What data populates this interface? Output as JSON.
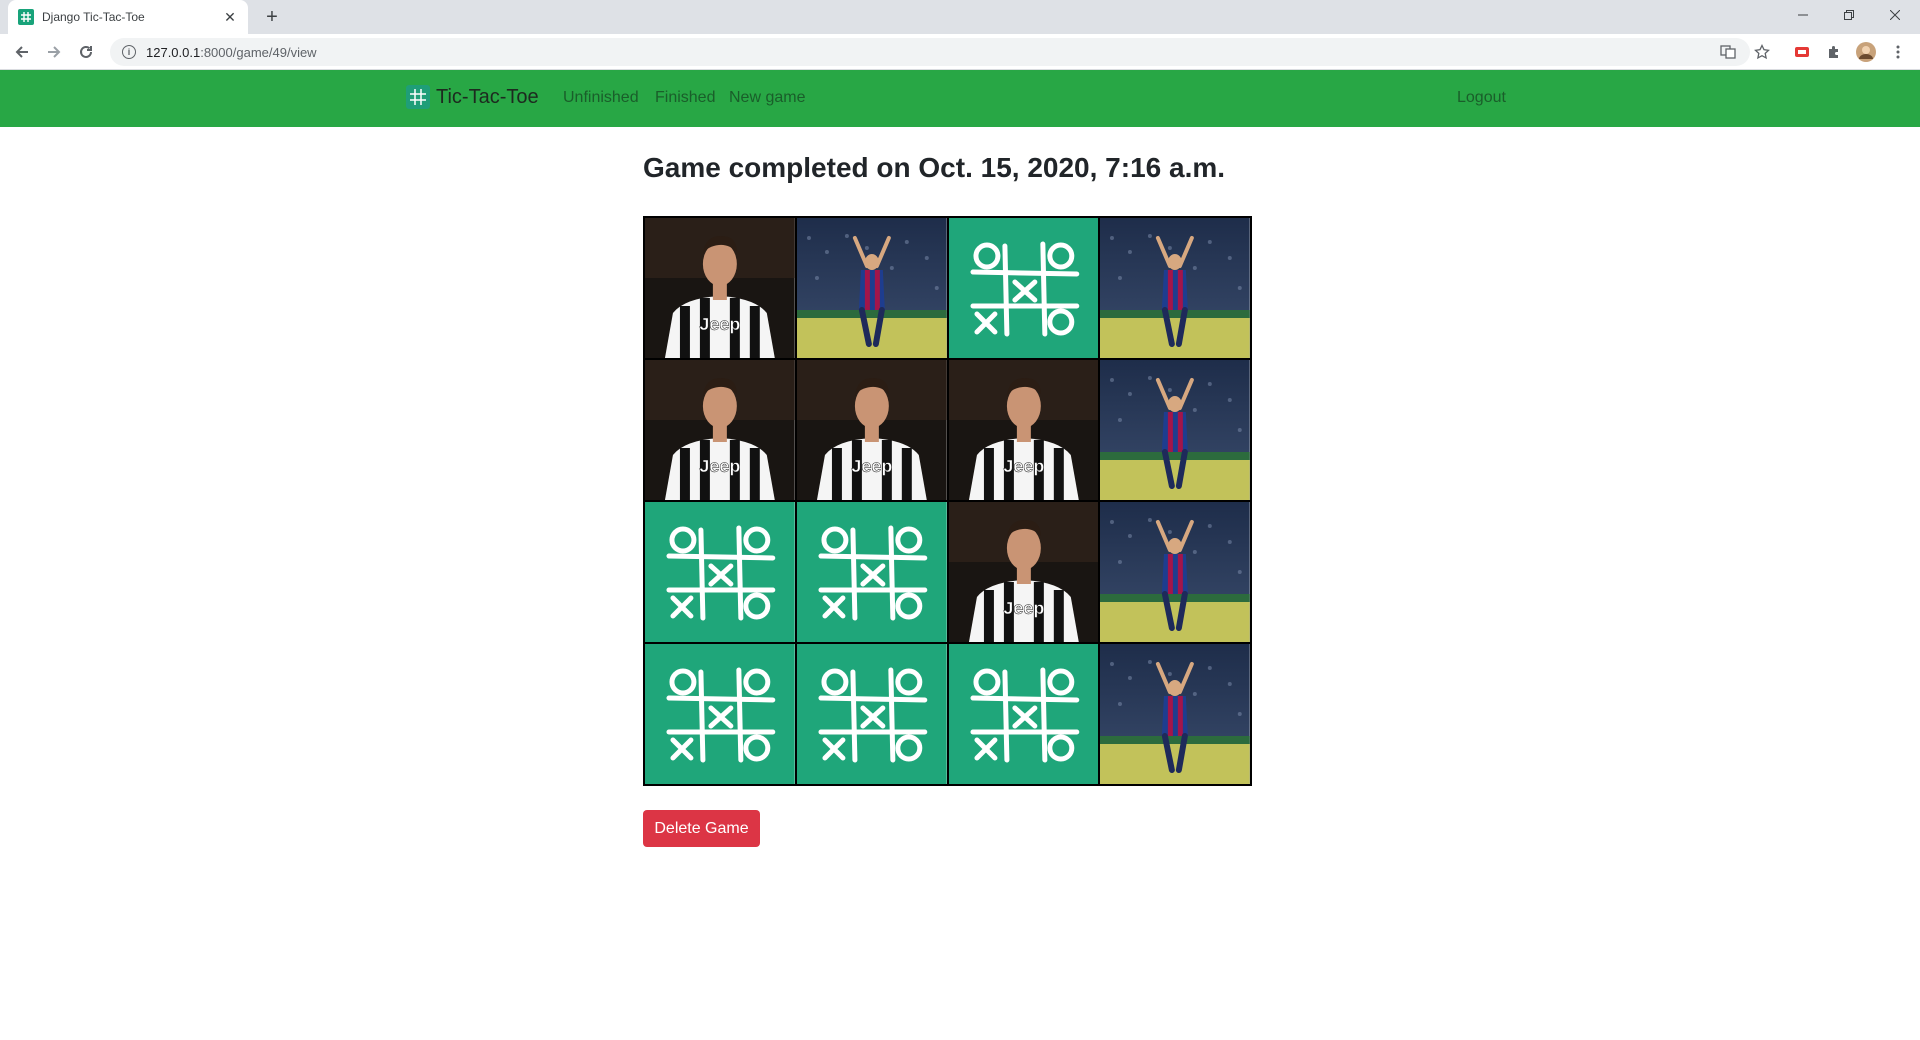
{
  "browser": {
    "tab_title": "Django Tic-Tac-Toe",
    "url_host": "127.0.0.1",
    "url_path": ":8000/game/49/view"
  },
  "navbar": {
    "brand": "Tic-Tac-Toe",
    "links": [
      "Unfinished",
      "Finished",
      "New game"
    ],
    "logout": "Logout"
  },
  "page": {
    "heading": "Game completed on Oct. 15, 2020, 7:16 a.m."
  },
  "board": {
    "rows": [
      [
        "player-x",
        "player-o",
        "empty",
        "player-o"
      ],
      [
        "player-x",
        "player-x",
        "player-x",
        "player-o"
      ],
      [
        "empty",
        "empty",
        "player-x",
        "player-o"
      ],
      [
        "empty",
        "empty",
        "empty",
        "player-o"
      ]
    ]
  },
  "actions": {
    "delete": "Delete Game"
  },
  "colors": {
    "navbar": "#28a745",
    "empty_cell": "#1fa67a",
    "delete_button": "#dc3545"
  }
}
